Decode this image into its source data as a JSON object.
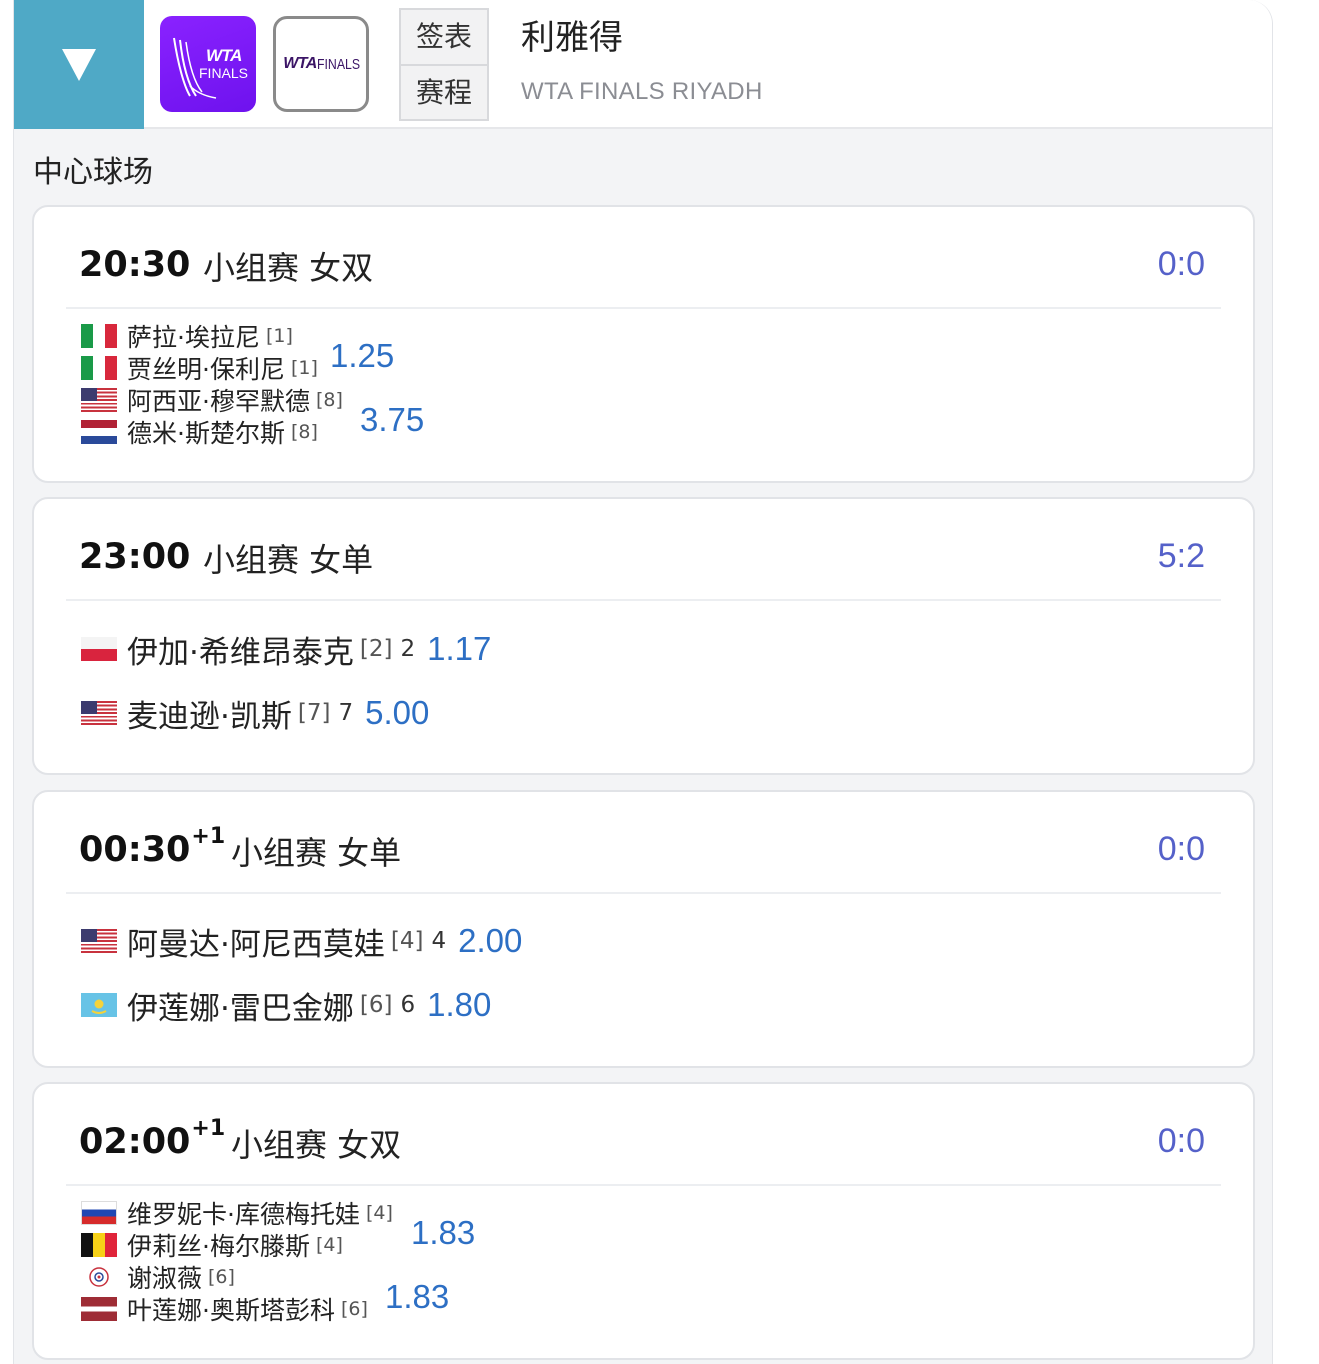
{
  "header": {
    "logo1": {
      "line1": "WTA",
      "line2": "FINALS"
    },
    "logo2": {
      "line1": "WTA",
      "line2": "FINALS"
    },
    "nav": [
      "签表",
      "赛程"
    ],
    "title": "利雅得",
    "subtitle": "WTA FINALS RIYADH"
  },
  "court": "中心球场",
  "colors": {
    "accent": "#4fa9c6",
    "score": "#5561c9",
    "odds": "#2d6fc4"
  },
  "matches": [
    {
      "time": "20:30",
      "day_offset": "",
      "round": "小组赛 女双",
      "score": "0:0",
      "teams": [
        {
          "odds": "1.25",
          "players": [
            {
              "flag": "italy-flag",
              "name": "萨拉·埃拉尼",
              "seed": "[1]"
            },
            {
              "flag": "italy-flag",
              "name": "贾丝明·保利尼",
              "seed": "[1]"
            }
          ]
        },
        {
          "odds": "3.75",
          "players": [
            {
              "flag": "usa-flag",
              "name": "阿西亚·穆罕默德",
              "seed": "[8]"
            },
            {
              "flag": "netherlands-flag",
              "name": "德米·斯楚尔斯",
              "seed": "[8]"
            }
          ]
        }
      ]
    },
    {
      "time": "23:00",
      "day_offset": "",
      "round": "小组赛 女单",
      "score": "5:2",
      "players": [
        {
          "flag": "poland-flag",
          "name": "伊加·希维昂泰克",
          "seed": "[2]",
          "sets": "2",
          "odds": "1.17"
        },
        {
          "flag": "usa-flag",
          "name": "麦迪逊·凯斯",
          "seed": "[7]",
          "sets": "7",
          "odds": "5.00"
        }
      ]
    },
    {
      "time": "00:30",
      "day_offset": "+1",
      "round": "小组赛 女单",
      "score": "0:0",
      "players": [
        {
          "flag": "usa-flag",
          "name": "阿曼达·阿尼西莫娃",
          "seed": "[4]",
          "sets": "4",
          "odds": "2.00"
        },
        {
          "flag": "kazakhstan-flag",
          "name": "伊莲娜·雷巴金娜",
          "seed": "[6]",
          "sets": "6",
          "odds": "1.80"
        }
      ]
    },
    {
      "time": "02:00",
      "day_offset": "+1",
      "round": "小组赛 女双",
      "score": "0:0",
      "teams": [
        {
          "odds": "1.83",
          "players": [
            {
              "flag": "russia-flag",
              "name": "维罗妮卡·库德梅托娃",
              "seed": "[4]"
            },
            {
              "flag": "belgium-flag",
              "name": "伊莉丝·梅尔滕斯",
              "seed": "[4]"
            }
          ]
        },
        {
          "odds": "1.83",
          "players": [
            {
              "flag": "chinese-taipei-flag",
              "name": "谢淑薇",
              "seed": "[6]"
            },
            {
              "flag": "latvia-flag",
              "name": "叶莲娜·奥斯塔彭科",
              "seed": "[6]"
            }
          ]
        }
      ]
    }
  ]
}
